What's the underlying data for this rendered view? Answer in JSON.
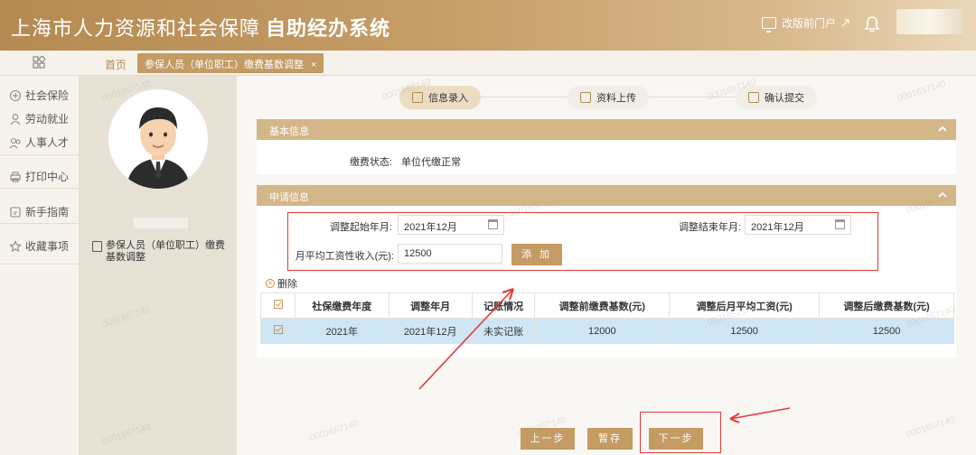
{
  "header": {
    "title_light": "上海市人力资源和社会保障",
    "title_bold": "自助经办系统",
    "portal_label": "改版前门户"
  },
  "tabbar": {
    "home": "首页",
    "active_tab": "参保人员（单位职工）缴费基数调整",
    "close": "×"
  },
  "leftnav": {
    "items": [
      {
        "label": "社会保险",
        "icon": "social-insurance-icon"
      },
      {
        "label": "劳动就业",
        "icon": "employment-icon"
      },
      {
        "label": "人事人才",
        "icon": "talent-icon"
      },
      {
        "label": "打印中心",
        "icon": "printer-icon"
      },
      {
        "label": "新手指南",
        "icon": "guide-icon"
      },
      {
        "label": "收藏事项",
        "icon": "star-icon"
      }
    ]
  },
  "profile": {
    "menu_item": "参保人员（单位职工）缴费基数调整"
  },
  "steps": [
    {
      "label": "信息录入"
    },
    {
      "label": "资料上传"
    },
    {
      "label": "确认提交"
    }
  ],
  "basic": {
    "title": "基本信息",
    "status_label": "缴费状态:",
    "status_value": "单位代缴正常"
  },
  "apply": {
    "title": "申请信息",
    "start_label": "调整起始年月:",
    "start_value": "2021年12月",
    "end_label": "调整结束年月:",
    "end_value": "2021年12月",
    "income_label": "月平均工资性收入(元):",
    "income_value": "12500",
    "add_button": "添 加"
  },
  "table": {
    "delete_label": "删除",
    "headers": [
      "社保缴费年度",
      "调整年月",
      "记账情况",
      "调整前缴费基数(元)",
      "调整后月平均工资(元)",
      "调整后缴费基数(元)"
    ],
    "rows": [
      [
        "2021年",
        "2021年12月",
        "未实记账",
        "12000",
        "12500",
        "12500"
      ]
    ]
  },
  "footer": {
    "prev": "上一步",
    "save": "暂存",
    "next": "下一步"
  },
  "watermark": "0001657140",
  "colors": {
    "accent": "#c39b63",
    "header_gradient_start": "#b58a52",
    "section_head": "#d4b789",
    "selected_row": "#cfe6f6",
    "annotation_red": "#e03a3a"
  }
}
